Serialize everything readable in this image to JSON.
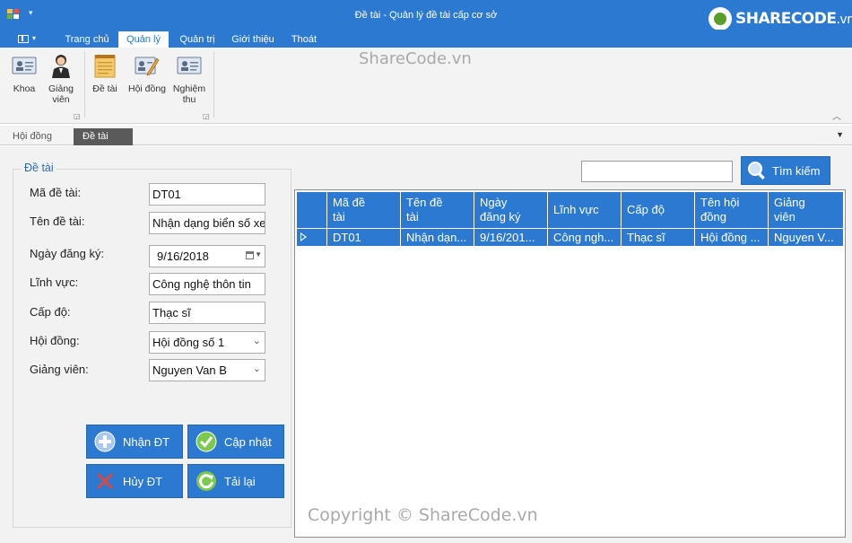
{
  "window": {
    "title": "Đề tài - Quản lý đề tài cấp cơ sở",
    "logo_text": "SHARECODE",
    "logo_suffix": ".vn"
  },
  "ribbon": {
    "tabs": [
      {
        "label": "Trang chủ",
        "active": false
      },
      {
        "label": "Quản lý",
        "active": true
      },
      {
        "label": "Quản trị",
        "active": false
      },
      {
        "label": "Giới thiệu",
        "active": false
      },
      {
        "label": "Thoát",
        "active": false
      }
    ],
    "buttons": [
      {
        "label": "Khoa",
        "icon": "department-icon"
      },
      {
        "label": "Giảng\nviên",
        "icon": "lecturer-icon"
      },
      {
        "label": "Đề tài",
        "icon": "notepad-icon"
      },
      {
        "label": "Hội đồng",
        "icon": "edit-card-icon"
      },
      {
        "label": "Nghiệm\nthu",
        "icon": "id-card-icon"
      }
    ]
  },
  "doc_tabs": [
    {
      "label": "Hội đồng",
      "active": false
    },
    {
      "label": "Đề tài",
      "active": true
    }
  ],
  "form": {
    "group_title": "Đề tài",
    "fields": {
      "ma_de_tai": {
        "label": "Mã đề tài:",
        "value": "DT01"
      },
      "ten_de_tai": {
        "label": "Tên đề tài:",
        "value": "Nhận dạng biển số xe"
      },
      "ngay_dang_ky": {
        "label": "Ngày đăng ký:",
        "value": "9/16/2018"
      },
      "linh_vuc": {
        "label": "Lĩnh vực:",
        "value": "Công nghệ thôn tin"
      },
      "cap_do": {
        "label": "Cấp độ:",
        "value": "Thạc sĩ"
      },
      "hoi_dong": {
        "label": "Hội đồng:",
        "value": "Hội đồng số 1"
      },
      "giang_vien": {
        "label": "Giảng viên:",
        "value": "Nguyen Van B"
      }
    },
    "buttons": {
      "add": "Nhận ĐT",
      "update": "Cập nhật",
      "cancel": "Hủy ĐT",
      "reload": "Tải lại"
    }
  },
  "search": {
    "value": "",
    "button_label": "Tìm kiếm"
  },
  "grid": {
    "columns": [
      "Mã đề tài",
      "Tên đề tài",
      "Ngày đăng ký",
      "Lĩnh vực",
      "Cấp độ",
      "Tên hội đồng",
      "Giảng viên"
    ],
    "column_lines": [
      [
        "Mã đề",
        "tài"
      ],
      [
        "Tên đề",
        "tài"
      ],
      [
        "Ngày",
        "đăng ký"
      ],
      [
        "Lĩnh vực"
      ],
      [
        "Cấp độ"
      ],
      [
        "Tên hội",
        "đồng"
      ],
      [
        "Giảng",
        "viên"
      ]
    ],
    "rows": [
      [
        "DT01",
        "Nhận dạn...",
        "9/16/201...",
        "Công ngh...",
        "Thạc sĩ",
        "Hội đồng ...",
        "Nguyen V..."
      ]
    ]
  },
  "watermarks": {
    "top": "ShareCode.vn",
    "bottom": "Copyright © ShareCode.vn"
  },
  "colors": {
    "accent": "#2b79d0",
    "group_title": "#2b6cb3",
    "form_bg": "#f2f2f2"
  }
}
